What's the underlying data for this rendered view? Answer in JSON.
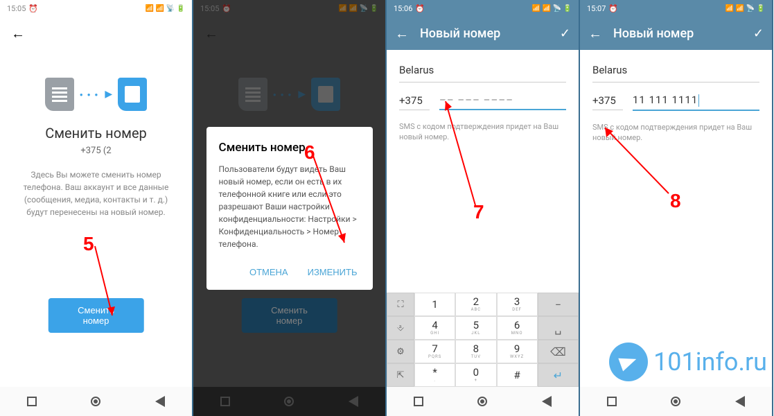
{
  "annotations": {
    "n5": "5",
    "n6": "6",
    "n7": "7",
    "n8": "8"
  },
  "watermark": "101info.ru",
  "screen1": {
    "time": "15:05",
    "title": "Сменить номер",
    "phone": "+375 (2",
    "desc": "Здесь Вы можете сменить номер телефона. Ваш аккаунт и все данные (сообщения, медиа, контакты и т. д.) будут перенесены на новый номер.",
    "button": "Сменить номер"
  },
  "screen2": {
    "time": "15:05",
    "button": "Сменить номер",
    "dialog": {
      "title": "Сменить номер",
      "body": "Пользователи будут видеть Ваш новый номер, если он есть в их телефонной книге или если это разрешают Ваши настройки конфиденциальности: Настройки > Конфиденциальность > Номер телефона.",
      "cancel": "ОТМЕНА",
      "confirm": "ИЗМЕНИТЬ"
    }
  },
  "screen3": {
    "time": "15:06",
    "header": "Новый номер",
    "country": "Belarus",
    "code": "+375",
    "placeholder": "–– ––– ––––",
    "hint": "SMS с кодом подтверждения придет на Ваш новый номер.",
    "keypad": {
      "keys": [
        {
          "n": "1",
          "s": ""
        },
        {
          "n": "2",
          "s": "ABC"
        },
        {
          "n": "3",
          "s": "DEF"
        },
        {
          "n": "4",
          "s": "GHI"
        },
        {
          "n": "5",
          "s": "JKL"
        },
        {
          "n": "6",
          "s": "MNO"
        },
        {
          "n": "7",
          "s": "PQRS"
        },
        {
          "n": "8",
          "s": "TUV"
        },
        {
          "n": "9",
          "s": "WXYZ"
        },
        {
          "n": "*",
          "s": "."
        },
        {
          "n": "0",
          "s": "+"
        },
        {
          "n": "#",
          "s": ""
        }
      ]
    }
  },
  "screen4": {
    "time": "15:07",
    "header": "Новый номер",
    "country": "Belarus",
    "code": "+375",
    "value": "11 111 1111",
    "hint": "SMS с кодом подтверждения придет на Ваш новый номер."
  }
}
